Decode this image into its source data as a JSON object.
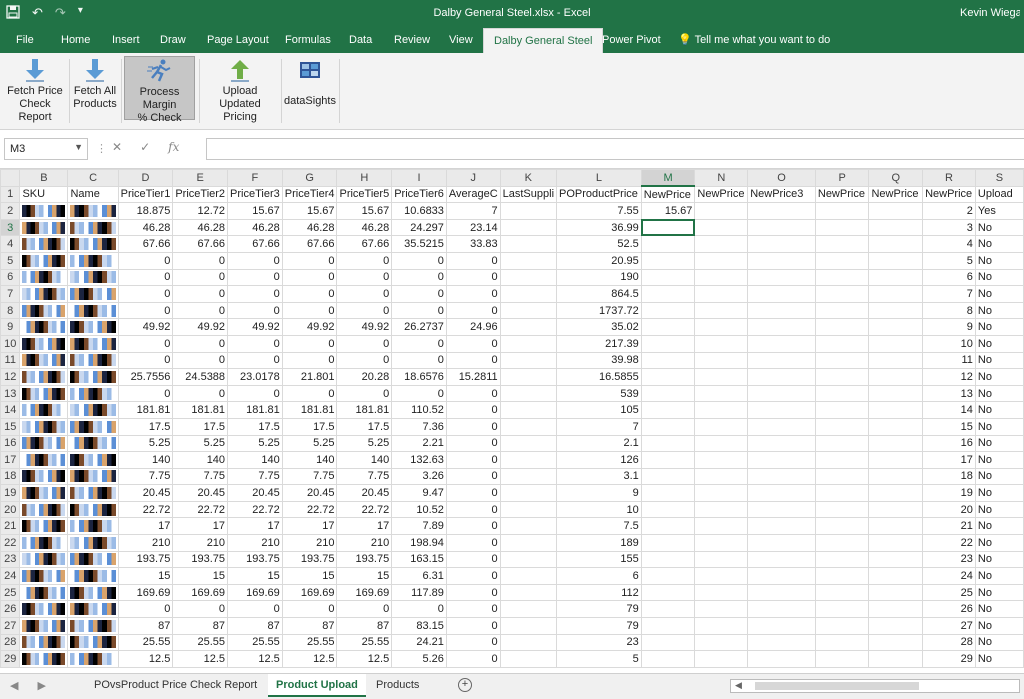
{
  "window": {
    "title": "Dalby General Steel.xlsx  -  Excel",
    "user": "Kevin Wiega"
  },
  "qat": {
    "save_icon": "save-icon",
    "undo_icon": "undo-icon",
    "redo_icon": "redo-icon"
  },
  "tabs": [
    "File",
    "Home",
    "Insert",
    "Draw",
    "Page Layout",
    "Formulas",
    "Data",
    "Review",
    "View",
    "Dalby General Steel",
    "Power Pivot"
  ],
  "tell_me": "Tell me what you want to do",
  "ribbon": {
    "fetch_price_label": [
      "Fetch Price",
      "Check Report"
    ],
    "fetch_all_label": [
      "Fetch All",
      "Products"
    ],
    "process_margin_label": [
      "Process Margin",
      "% Check"
    ],
    "upload_label": [
      "Upload",
      "Updated Pricing"
    ],
    "datasights_label": "dataSights",
    "accent": "#217346"
  },
  "formula_bar": {
    "name_box": "M3",
    "fx": "fx",
    "cancel": "✕",
    "enter": "✓",
    "formula": ""
  },
  "grid": {
    "column_headers": [
      "B",
      "C",
      "D",
      "E",
      "F",
      "G",
      "H",
      "I",
      "J",
      "K",
      "L",
      "M",
      "N",
      "O",
      "P",
      "Q",
      "R",
      "S"
    ],
    "field_names": [
      "SKU",
      "Name",
      "PriceTier1",
      "PriceTier2",
      "PriceTier3",
      "PriceTier4",
      "PriceTier5",
      "PriceTier6",
      "AverageC",
      "LastSuppli",
      "POProductPrice",
      "NewPrice",
      "NewPrice",
      "NewPrice3",
      "NewPrice",
      "NewPrice",
      "NewPrice",
      "Upload"
    ],
    "active_cell": "M3",
    "rows": [
      {
        "r": "2",
        "d": "18.875",
        "e": "12.72",
        "f": "15.67",
        "g": "15.67",
        "h": "15.67",
        "i": "10.6833",
        "j": "7",
        "l": "7.55",
        "m": "15.67",
        "s": "Yes"
      },
      {
        "r": "3",
        "d": "46.28",
        "e": "46.28",
        "f": "46.28",
        "g": "46.28",
        "h": "46.28",
        "i": "24.297",
        "j": "23.14",
        "l": "36.99",
        "m": "",
        "s": "No"
      },
      {
        "r": "4",
        "d": "67.66",
        "e": "67.66",
        "f": "67.66",
        "g": "67.66",
        "h": "67.66",
        "i": "35.5215",
        "j": "33.83",
        "l": "52.5",
        "m": "",
        "s": "No"
      },
      {
        "r": "5",
        "d": "0",
        "e": "0",
        "f": "0",
        "g": "0",
        "h": "0",
        "i": "0",
        "j": "0",
        "l": "20.95",
        "m": "",
        "s": "No"
      },
      {
        "r": "6",
        "d": "0",
        "e": "0",
        "f": "0",
        "g": "0",
        "h": "0",
        "i": "0",
        "j": "0",
        "l": "190",
        "m": "",
        "s": "No"
      },
      {
        "r": "7",
        "d": "0",
        "e": "0",
        "f": "0",
        "g": "0",
        "h": "0",
        "i": "0",
        "j": "0",
        "l": "864.5",
        "m": "",
        "s": "No"
      },
      {
        "r": "8",
        "d": "0",
        "e": "0",
        "f": "0",
        "g": "0",
        "h": "0",
        "i": "0",
        "j": "0",
        "l": "1737.72",
        "m": "",
        "s": "No"
      },
      {
        "r": "9",
        "d": "49.92",
        "e": "49.92",
        "f": "49.92",
        "g": "49.92",
        "h": "49.92",
        "i": "26.2737",
        "j": "24.96",
        "l": "35.02",
        "m": "",
        "s": "No"
      },
      {
        "r": "10",
        "d": "0",
        "e": "0",
        "f": "0",
        "g": "0",
        "h": "0",
        "i": "0",
        "j": "0",
        "l": "217.39",
        "m": "",
        "s": "No"
      },
      {
        "r": "11",
        "d": "0",
        "e": "0",
        "f": "0",
        "g": "0",
        "h": "0",
        "i": "0",
        "j": "0",
        "l": "39.98",
        "m": "",
        "s": "No"
      },
      {
        "r": "12",
        "d": "25.7556",
        "e": "24.5388",
        "f": "23.0178",
        "g": "21.801",
        "h": "20.28",
        "i": "18.6576",
        "j": "15.2811",
        "l": "16.5855",
        "m": "",
        "s": "No"
      },
      {
        "r": "13",
        "d": "0",
        "e": "0",
        "f": "0",
        "g": "0",
        "h": "0",
        "i": "0",
        "j": "0",
        "l": "539",
        "m": "",
        "s": "No"
      },
      {
        "r": "14",
        "d": "181.81",
        "e": "181.81",
        "f": "181.81",
        "g": "181.81",
        "h": "181.81",
        "i": "110.52",
        "j": "0",
        "l": "105",
        "m": "",
        "s": "No"
      },
      {
        "r": "15",
        "d": "17.5",
        "e": "17.5",
        "f": "17.5",
        "g": "17.5",
        "h": "17.5",
        "i": "7.36",
        "j": "0",
        "l": "7",
        "m": "",
        "s": "No"
      },
      {
        "r": "16",
        "d": "5.25",
        "e": "5.25",
        "f": "5.25",
        "g": "5.25",
        "h": "5.25",
        "i": "2.21",
        "j": "0",
        "l": "2.1",
        "m": "",
        "s": "No"
      },
      {
        "r": "17",
        "d": "140",
        "e": "140",
        "f": "140",
        "g": "140",
        "h": "140",
        "i": "132.63",
        "j": "0",
        "l": "126",
        "m": "",
        "s": "No"
      },
      {
        "r": "18",
        "d": "7.75",
        "e": "7.75",
        "f": "7.75",
        "g": "7.75",
        "h": "7.75",
        "i": "3.26",
        "j": "0",
        "l": "3.1",
        "m": "",
        "s": "No"
      },
      {
        "r": "19",
        "d": "20.45",
        "e": "20.45",
        "f": "20.45",
        "g": "20.45",
        "h": "20.45",
        "i": "9.47",
        "j": "0",
        "l": "9",
        "m": "",
        "s": "No"
      },
      {
        "r": "20",
        "d": "22.72",
        "e": "22.72",
        "f": "22.72",
        "g": "22.72",
        "h": "22.72",
        "i": "10.52",
        "j": "0",
        "l": "10",
        "m": "",
        "s": "No"
      },
      {
        "r": "21",
        "d": "17",
        "e": "17",
        "f": "17",
        "g": "17",
        "h": "17",
        "i": "7.89",
        "j": "0",
        "l": "7.5",
        "m": "",
        "s": "No"
      },
      {
        "r": "22",
        "d": "210",
        "e": "210",
        "f": "210",
        "g": "210",
        "h": "210",
        "i": "198.94",
        "j": "0",
        "l": "189",
        "m": "",
        "s": "No"
      },
      {
        "r": "23",
        "d": "193.75",
        "e": "193.75",
        "f": "193.75",
        "g": "193.75",
        "h": "193.75",
        "i": "163.15",
        "j": "0",
        "l": "155",
        "m": "",
        "s": "No"
      },
      {
        "r": "24",
        "d": "15",
        "e": "15",
        "f": "15",
        "g": "15",
        "h": "15",
        "i": "6.31",
        "j": "0",
        "l": "6",
        "m": "",
        "s": "No"
      },
      {
        "r": "25",
        "d": "169.69",
        "e": "169.69",
        "f": "169.69",
        "g": "169.69",
        "h": "169.69",
        "i": "117.89",
        "j": "0",
        "l": "112",
        "m": "",
        "s": "No"
      },
      {
        "r": "26",
        "d": "0",
        "e": "0",
        "f": "0",
        "g": "0",
        "h": "0",
        "i": "0",
        "j": "0",
        "l": "79",
        "m": "",
        "s": "No"
      },
      {
        "r": "27",
        "d": "87",
        "e": "87",
        "f": "87",
        "g": "87",
        "h": "87",
        "i": "83.15",
        "j": "0",
        "l": "79",
        "m": "",
        "s": "No"
      },
      {
        "r": "28",
        "d": "25.55",
        "e": "25.55",
        "f": "25.55",
        "g": "25.55",
        "h": "25.55",
        "i": "24.21",
        "j": "0",
        "l": "23",
        "m": "",
        "s": "No"
      },
      {
        "r": "29",
        "d": "12.5",
        "e": "12.5",
        "f": "12.5",
        "g": "12.5",
        "h": "12.5",
        "i": "5.26",
        "j": "0",
        "l": "5",
        "m": "",
        "s": "No"
      }
    ]
  },
  "sheets": [
    "POvsProduct Price Check Report",
    "Product Upload",
    "Products"
  ],
  "active_sheet": "Product Upload",
  "sheet_nav": "◀ ▶",
  "add_sheet": "+"
}
